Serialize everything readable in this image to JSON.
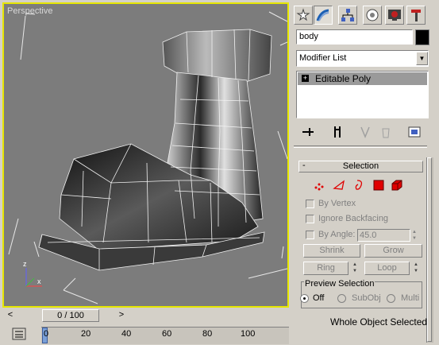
{
  "viewport": {
    "label": "Perspective",
    "border_color": "#e6e600",
    "bg_color": "#7c7c7c"
  },
  "timeline": {
    "prev": "<",
    "next": ">",
    "frame": "0 / 100",
    "ticks": [
      "0",
      "20",
      "40",
      "60",
      "80",
      "100"
    ]
  },
  "panel": {
    "tabs": [
      "create-icon",
      "modify-icon",
      "hierarchy-icon",
      "motion-icon",
      "display-icon",
      "utilities-icon"
    ],
    "object_name": "body",
    "object_color": "#000000",
    "modifier_list": "Modifier List",
    "stack": {
      "expand": "+",
      "item": "Editable Poly"
    }
  },
  "selection": {
    "title": "Selection",
    "collapse": "-",
    "by_vertex": "By Vertex",
    "ignore_backfacing": "Ignore Backfacing",
    "by_angle": "By Angle:",
    "angle_value": "45.0",
    "shrink": "Shrink",
    "grow": "Grow",
    "ring": "Ring",
    "loop": "Loop",
    "preview_title": "Preview Selection",
    "preview_off": "Off",
    "preview_subobj": "SubObj",
    "preview_multi": "Multi",
    "status": "Whole Object Selected"
  }
}
